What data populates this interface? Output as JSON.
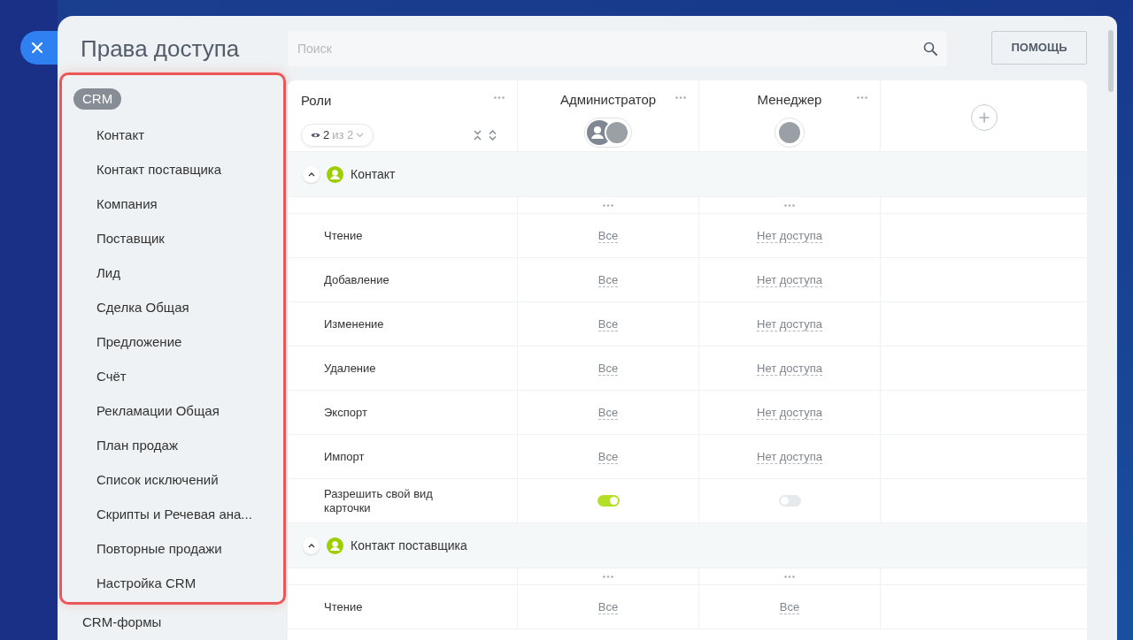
{
  "title": "Права доступа",
  "search": {
    "placeholder": "Поиск"
  },
  "help_button": "ПОМОЩЬ",
  "sidebar": {
    "group": "CRM",
    "items": [
      {
        "label": "Контакт"
      },
      {
        "label": "Контакт поставщика"
      },
      {
        "label": "Компания"
      },
      {
        "label": "Поставщик"
      },
      {
        "label": "Лид"
      },
      {
        "label": "Сделка Общая"
      },
      {
        "label": "Предложение"
      },
      {
        "label": "Счёт"
      },
      {
        "label": "Рекламации Общая"
      },
      {
        "label": "План продаж"
      },
      {
        "label": "Список исключений"
      },
      {
        "label": "Скрипты и Речевая ана..."
      },
      {
        "label": "Повторные продажи"
      },
      {
        "label": "Настройка CRM"
      }
    ],
    "next_item": "CRM-формы"
  },
  "table": {
    "roles_header": "Роли",
    "visible_count": "2",
    "visible_total": "из 2",
    "roles": [
      {
        "name": "Администратор",
        "avatars": [
          {
            "kind": "group"
          },
          {
            "kind": "photo"
          }
        ]
      },
      {
        "name": "Менеджер",
        "avatars": [
          {
            "kind": "photo"
          }
        ]
      }
    ],
    "sections": [
      {
        "title": "Контакт",
        "expanded": true,
        "rows": [
          {
            "kind": "access",
            "label": "Чтение",
            "values": [
              "Все",
              "Нет доступа"
            ]
          },
          {
            "kind": "access",
            "label": "Добавление",
            "values": [
              "Все",
              "Нет доступа"
            ]
          },
          {
            "kind": "access",
            "label": "Изменение",
            "values": [
              "Все",
              "Нет доступа"
            ]
          },
          {
            "kind": "access",
            "label": "Удаление",
            "values": [
              "Все",
              "Нет доступа"
            ]
          },
          {
            "kind": "access",
            "label": "Экспорт",
            "values": [
              "Все",
              "Нет доступа"
            ]
          },
          {
            "kind": "access",
            "label": "Импорт",
            "values": [
              "Все",
              "Нет доступа"
            ]
          },
          {
            "kind": "toggle",
            "label": "Разрешить свой вид карточки",
            "on": [
              true,
              false
            ]
          }
        ]
      },
      {
        "title": "Контакт поставщика",
        "expanded": true,
        "rows": [
          {
            "kind": "access",
            "label": "Чтение",
            "values": [
              "Все",
              "Все"
            ]
          }
        ]
      }
    ]
  }
}
